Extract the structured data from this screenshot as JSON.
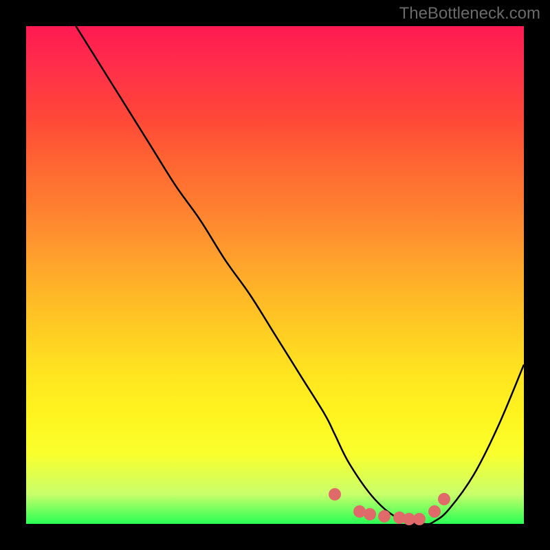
{
  "watermark": "TheBottleneck.com",
  "chart_data": {
    "type": "line",
    "title": "",
    "xlabel": "",
    "ylabel": "",
    "xlim": [
      0,
      100
    ],
    "ylim": [
      0,
      100
    ],
    "grid": false,
    "series": [
      {
        "name": "curve",
        "x": [
          10,
          15,
          20,
          25,
          30,
          35,
          40,
          45,
          50,
          55,
          60,
          62,
          65,
          70,
          75,
          80,
          82,
          85,
          90,
          95,
          100
        ],
        "y": [
          100,
          92,
          84,
          76,
          68,
          61,
          53,
          46,
          38,
          30,
          22,
          18,
          12,
          5,
          1,
          0,
          0.5,
          3,
          10,
          20,
          32
        ],
        "color": "#000000"
      }
    ],
    "markers": [
      {
        "x": 62,
        "y": 6
      },
      {
        "x": 67,
        "y": 2.5
      },
      {
        "x": 69,
        "y": 2
      },
      {
        "x": 72,
        "y": 1.5
      },
      {
        "x": 75,
        "y": 1.2
      },
      {
        "x": 77,
        "y": 1
      },
      {
        "x": 79,
        "y": 1
      },
      {
        "x": 82,
        "y": 2.5
      },
      {
        "x": 84,
        "y": 5
      }
    ],
    "marker_color": "#e06a6a"
  }
}
